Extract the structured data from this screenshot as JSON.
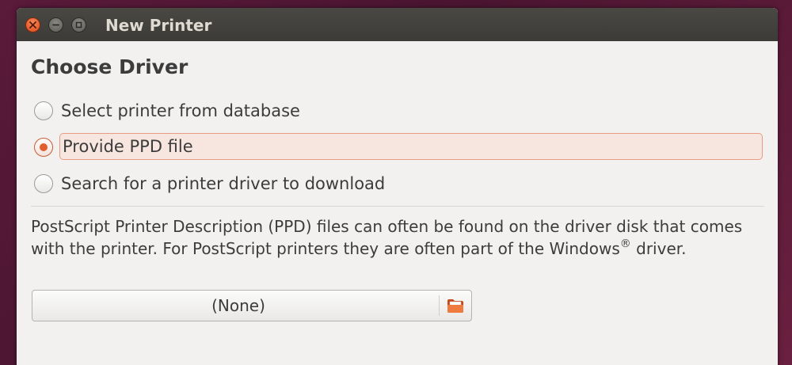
{
  "window": {
    "title": "New Printer"
  },
  "titlebar_buttons": {
    "close_icon": "close-icon",
    "minimize_icon": "minimize-icon",
    "maximize_icon": "maximize-icon"
  },
  "page": {
    "heading": "Choose Driver"
  },
  "options": [
    {
      "label": "Select printer from database",
      "checked": false
    },
    {
      "label": "Provide PPD file",
      "checked": true
    },
    {
      "label": "Search for a printer driver to download",
      "checked": false
    }
  ],
  "description": {
    "text": "PostScript Printer Description (PPD) files can often be found on the driver disk that comes with the printer. For PostScript printers they are often part of the Windows",
    "trademark": "®",
    "text_after": " driver."
  },
  "file_chooser": {
    "value": "(None)",
    "icon": "folder-icon"
  },
  "colors": {
    "accent": "#e06030",
    "window_bg": "#f2f1f0",
    "titlebar": "#3c3b37",
    "selected_bg": "#f7e6df"
  }
}
